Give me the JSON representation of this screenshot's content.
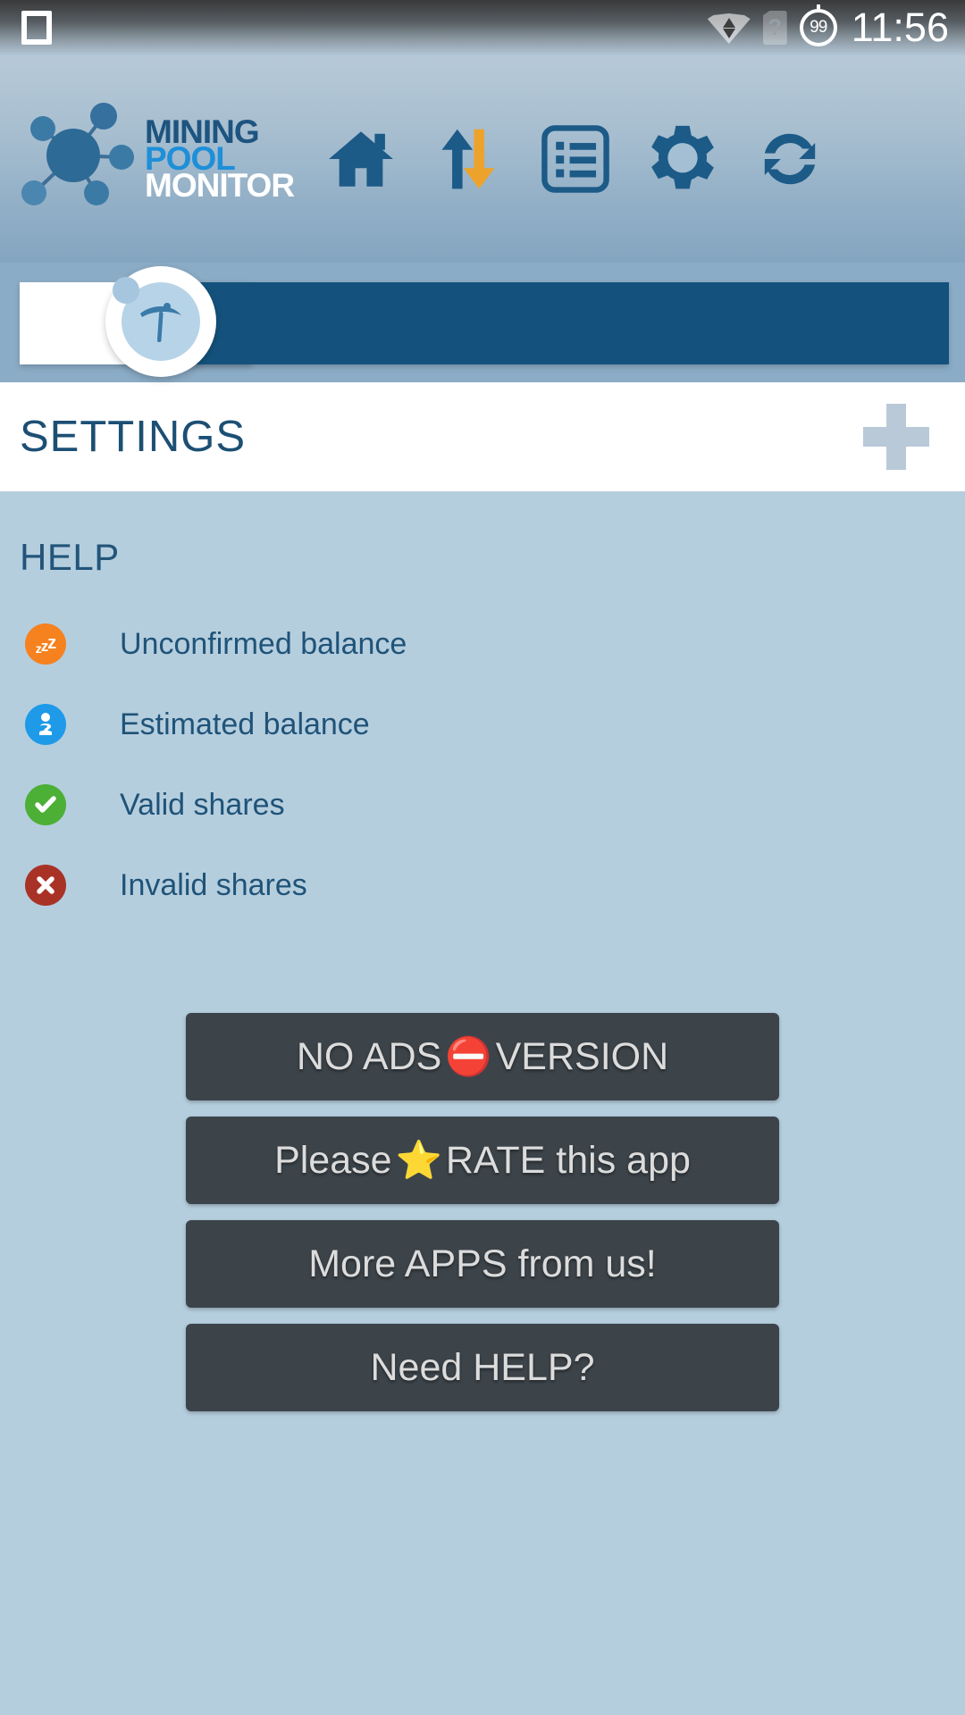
{
  "status_bar": {
    "screenshot_icon": "screenshot-square-icon",
    "wifi_icon": "wifi-transfer-icon",
    "sim_icon": "sim-card-unknown-icon",
    "sim_glyph": "?",
    "battery_icon": "battery-circle-icon",
    "battery_level": "99",
    "time": "11:56"
  },
  "app_header": {
    "logo_icon": "network-nodes-logo",
    "brand_line1": "MINING",
    "brand_line2": "POOL",
    "brand_line3": "MONITOR",
    "actions": [
      {
        "name": "home-icon",
        "label": "Home"
      },
      {
        "name": "transfers-icon",
        "label": "Transfers"
      },
      {
        "name": "list-icon",
        "label": "Workers list"
      },
      {
        "name": "gear-icon",
        "label": "Settings"
      },
      {
        "name": "refresh-icon",
        "label": "Refresh"
      }
    ],
    "colors": {
      "brand_dark": "#1d5480",
      "brand_bright": "#1e8fd8",
      "brand_white": "#ffffff",
      "icon_blue": "#1c5a87",
      "icon_orange": "#eda32b"
    }
  },
  "ad_banner": {
    "name": "advertisement-banner",
    "badge_icon": "pickaxe-icon",
    "navy_color": "#14527d",
    "band_color": "#8bacc6"
  },
  "title_bar": {
    "title": "SETTINGS",
    "add_button_icon": "plus-icon",
    "title_color": "#1c4f74"
  },
  "help_section": {
    "heading": "HELP",
    "legend": [
      {
        "icon": "sleep-zzz-icon",
        "glyph": "zzz",
        "color": "#f5821f",
        "label": "Unconfirmed balance"
      },
      {
        "icon": "question-mark-icon",
        "glyph": "?",
        "color": "#1e9ae8",
        "label": "Estimated balance"
      },
      {
        "icon": "check-circle-icon",
        "glyph": "check",
        "color": "#4caf36",
        "label": "Valid shares"
      },
      {
        "icon": "x-circle-icon",
        "glyph": "cross",
        "color": "#a93226",
        "label": "Invalid shares"
      }
    ]
  },
  "action_buttons": [
    {
      "name": "no-ads-version-button",
      "text_before": "NO ADS",
      "emoji": "⛔",
      "emoji_name": "prohibited-icon",
      "text_after": "VERSION"
    },
    {
      "name": "rate-app-button",
      "text_before": "Please",
      "emoji": "⭐",
      "emoji_name": "star-icon",
      "text_after": "RATE this app"
    },
    {
      "name": "more-apps-button",
      "text_before": "More APPS from us!",
      "emoji": "",
      "emoji_name": "",
      "text_after": ""
    },
    {
      "name": "need-help-button",
      "text_before": "Need HELP?",
      "emoji": "",
      "emoji_name": "",
      "text_after": ""
    }
  ],
  "theme": {
    "background": "#b5cede",
    "header_band": "#8bacc6",
    "button_dark": "#3c444a",
    "button_text": "#dcdcdc"
  }
}
